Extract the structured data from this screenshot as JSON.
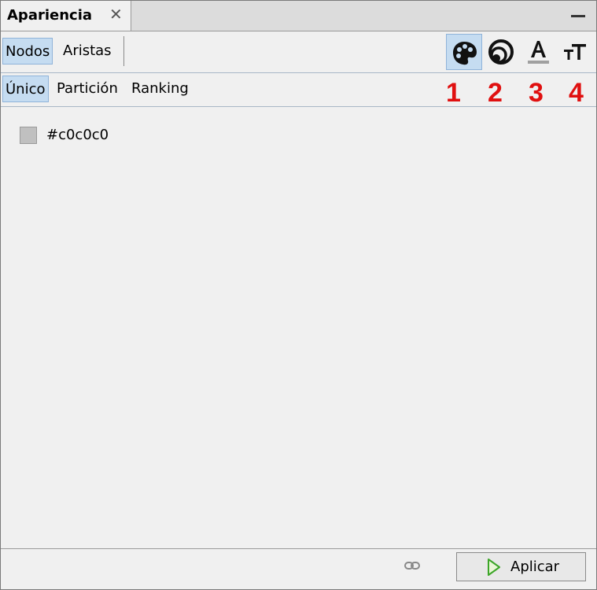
{
  "tab": {
    "title": "Apariencia",
    "close_symbol": "✕"
  },
  "element_tabs": [
    {
      "label": "Nodos",
      "selected": true
    },
    {
      "label": "Aristas",
      "selected": false
    }
  ],
  "transformers": [
    {
      "icon": "palette-icon",
      "number": "1",
      "selected": true
    },
    {
      "icon": "size-rings-icon",
      "number": "2",
      "selected": false
    },
    {
      "icon": "label-color-icon",
      "number": "3",
      "selected": false
    },
    {
      "icon": "label-size-icon",
      "number": "4",
      "selected": false
    }
  ],
  "mode_tabs": [
    {
      "label": "Único",
      "selected": true
    },
    {
      "label": "Partición",
      "selected": false
    },
    {
      "label": "Ranking",
      "selected": false
    }
  ],
  "color": {
    "value": "#c0c0c0",
    "label": "#c0c0c0"
  },
  "colors": {
    "accent_bg": "#c5dcf1",
    "accent_border": "#8fb3d9",
    "numbers": "#e01010",
    "panel": "#f0f0f0"
  },
  "footer": {
    "apply_label": "Aplicar"
  }
}
